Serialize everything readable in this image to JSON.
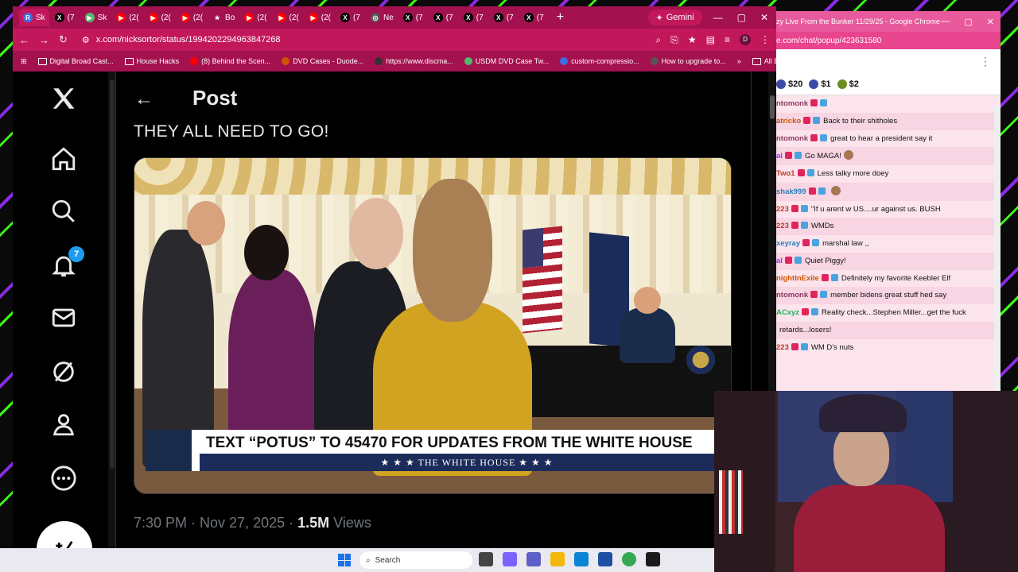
{
  "browser": {
    "tabs": [
      {
        "label": "Sk",
        "color": "#3a6ee8",
        "glyph": "R"
      },
      {
        "label": "(7",
        "color": "#000000",
        "glyph": "X"
      },
      {
        "label": "Sk",
        "color": "#53b96c",
        "glyph": "▶"
      },
      {
        "label": "(2(",
        "color": "#ff0000",
        "glyph": "▶"
      },
      {
        "label": "(2(",
        "color": "#ff0000",
        "glyph": "▶"
      },
      {
        "label": "(2(",
        "color": "#ff0000",
        "glyph": "▶"
      },
      {
        "label": "Bo",
        "color": "#a4114f",
        "glyph": "★"
      },
      {
        "label": "(2(",
        "color": "#ff0000",
        "glyph": "▶"
      },
      {
        "label": "(2(",
        "color": "#ff0000",
        "glyph": "▶"
      },
      {
        "label": "(2(",
        "color": "#ff0000",
        "glyph": "▶"
      },
      {
        "label": "(7",
        "color": "#000000",
        "glyph": "X"
      },
      {
        "label": "Ne",
        "color": "#555555",
        "glyph": "◎"
      },
      {
        "label": "(7",
        "color": "#000000",
        "glyph": "X"
      },
      {
        "label": "(7",
        "color": "#000000",
        "glyph": "X"
      },
      {
        "label": "(7",
        "color": "#000000",
        "glyph": "X"
      },
      {
        "label": "(7",
        "color": "#000000",
        "glyph": "X"
      },
      {
        "label": "(7",
        "color": "#000000",
        "glyph": "X"
      }
    ],
    "gemini_label": "Gemini",
    "url": "x.com/nicksortor/status/1994202294963847268",
    "bookmarks": [
      "Digital Broad Cast...",
      "House Hacks",
      "(8) Behind the Scen...",
      "DVD Cases - Duode...",
      "https://www.discma...",
      "USDM DVD Case Tw...",
      "custom-compressio...",
      "How to upgrade to..."
    ],
    "all_bookmarks": "All Bookmarks",
    "profile_initial": "D"
  },
  "x": {
    "notifications_count": "7",
    "post_title": "Post",
    "post_text": "THEY ALL NEED TO GO!",
    "chyron_main": "TEXT “POTUS” TO 45470 FOR UPDATES FROM THE WHITE HOUSE",
    "chyron_sub": "★ ★ ★   THE WHITE HOUSE   ★ ★ ★",
    "meta_time": "7:30 PM · Nov 27, 2025 · ",
    "meta_views_count": "1.5M",
    "meta_views_label": " Views"
  },
  "chat": {
    "window_title": "zy Live From the Bunker 11/29/25 - Google Chrome",
    "url": "e.com/chat/popup/423631580",
    "tips": [
      {
        "amount": "$20",
        "color": "#3b4aa8"
      },
      {
        "amount": "$1",
        "color": "#3b4aa8"
      },
      {
        "amount": "$2",
        "color": "#6b8e23"
      }
    ],
    "messages": [
      {
        "user": "ntomonk",
        "color": "#8b3a62",
        "text": ""
      },
      {
        "user": "atricko",
        "color": "#d35400",
        "text": "Back to their shitholes"
      },
      {
        "user": "ntomonk",
        "color": "#8b3a62",
        "text": "great to hear a president say it"
      },
      {
        "user": "al",
        "color": "#9b30ff",
        "text": "Go MAGA!"
      },
      {
        "user": "Two1",
        "color": "#c0392b",
        "text": "Less talky more doey"
      },
      {
        "user": "shak999",
        "color": "#2980b9",
        "text": ""
      },
      {
        "user": "223",
        "color": "#c0392b",
        "text": "\"If u arent w US....ur against us. BUSH"
      },
      {
        "user": "223",
        "color": "#c0392b",
        "text": "WMDs"
      },
      {
        "user": "xeyray",
        "color": "#2980b9",
        "text": "marshal law ,,"
      },
      {
        "user": "al",
        "color": "#9b30ff",
        "text": "Quiet Piggy!"
      },
      {
        "user": "nightInExile",
        "color": "#d35400",
        "text": "Definitely my favorite Keebler Elf"
      },
      {
        "user": "ntomonk",
        "color": "#8b3a62",
        "text": "member bidens great stuff hed say"
      },
      {
        "user": "ACxyz",
        "color": "#27ae60",
        "text": "Reality check...Stephen Miller...get the fuck"
      },
      {
        "user": "",
        "color": "#111111",
        "text": "retards...losers!"
      },
      {
        "user": "223",
        "color": "#c0392b",
        "text": "WM D's nuts"
      }
    ]
  },
  "taskbar": {
    "search_placeholder": "Search"
  }
}
